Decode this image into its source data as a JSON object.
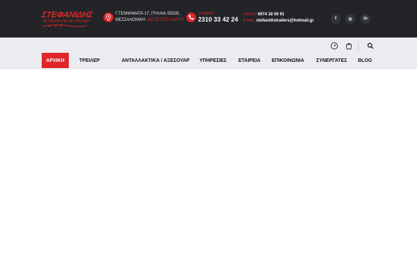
{
  "brand": {
    "logo_text": "ΣΤΕΦΑΝΙΔΗΣ",
    "logo_tagline": "ΤΑ ΠΑΝΤΑ ΓΙΑ ΤΑ ΤΡΕΙΛΕΡ"
  },
  "contact": {
    "address_line1": "Γ.ΓΕΝΝΗΜΑΤΑ 17, ΠΥΛΑΙΑ 55535,",
    "address_line2": "ΘΕΣΣΑΛΟΝΙΚΗ",
    "map_link": "ΔΕΙΤΕ ΣΤΟ ΧΑΡΤΗ",
    "phone_label": "ΣΤΑΘΕΡΟ",
    "phone_value": "2310 33 42 24",
    "mobile_label": "ΚΙΝΗΤΟ",
    "mobile_value": "6974 18 56 91",
    "email_label": "E-MAIL",
    "email_value": "stefanidistrailers@hotmail.gr"
  },
  "social": [
    {
      "icon": "facebook-icon",
      "glyph": "f"
    },
    {
      "icon": "instagram-icon",
      "glyph": "◎"
    },
    {
      "icon": "linkedin-icon",
      "glyph": "in"
    }
  ],
  "menu": {
    "items": [
      {
        "label": "ΑΡΧΙΚΗ",
        "active": true
      },
      {
        "label": "ΤΡΕΙΛΕΡ",
        "active": false
      },
      {
        "label": "ΑΝΤΑΛΛΑΚΤΙΚΑ / ΑΞΕΣΟΥΑΡ",
        "active": false
      },
      {
        "label": "ΥΠΗΡΕΣΙΕΣ",
        "active": false
      },
      {
        "label": "ΕΤΑΙΡΕΙΑ",
        "active": false
      },
      {
        "label": "ΕΠΙΚΟΙΝΩΝΙΑ",
        "active": false
      },
      {
        "label": "ΣΥΝΕΡΓΑΤΕΣ",
        "active": false
      },
      {
        "label": "BLOG",
        "active": false
      }
    ]
  },
  "colors": {
    "accent": "#e0262b",
    "topbar": "#222427",
    "navbar": "#eaecef"
  }
}
